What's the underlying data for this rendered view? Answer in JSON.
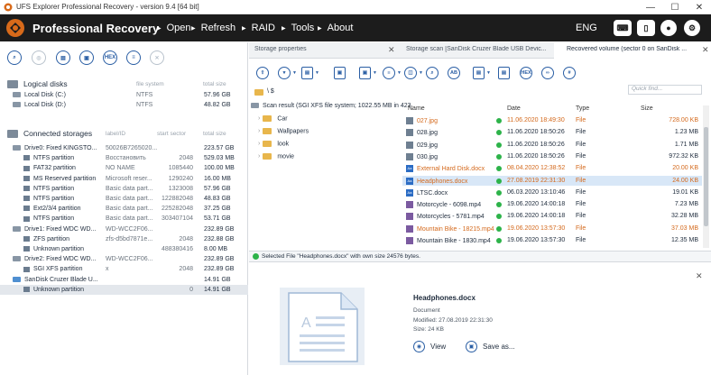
{
  "window": {
    "title": "UFS Explorer Professional Recovery - version 9.4 [64 bit]",
    "minimize": "—",
    "maximize": "☐",
    "close": "✕"
  },
  "menubar": {
    "brand": "Professional Recovery",
    "items": [
      "Open",
      "Refresh",
      "RAID",
      "Tools",
      "About"
    ],
    "language": "ENG"
  },
  "left_toolbar": [
    "search-icon",
    "globe-icon",
    "disk-icon",
    "lock-icon",
    "HEX",
    "list-icon",
    "close-icon"
  ],
  "logical_disks": {
    "title": "Logical disks",
    "col_fs": "file system",
    "col_size": "total size",
    "rows": [
      {
        "name": "Local Disk (C:)",
        "fs": "NTFS",
        "size": "57.96 GB"
      },
      {
        "name": "Local Disk (D:)",
        "fs": "NTFS",
        "size": "48.82 GB"
      }
    ]
  },
  "connected_storages": {
    "title": "Connected storages",
    "col_label": "label/ID",
    "col_start": "start sector",
    "col_size": "total size",
    "rows": [
      {
        "kind": "drive",
        "name": "Drive0: Fixed KINGSTO...",
        "label": "50026B7265020...",
        "start": "",
        "size": "223.57 GB"
      },
      {
        "kind": "part",
        "name": "NTFS partition",
        "label": "Восстановить",
        "start": "2048",
        "size": "529.03 MB"
      },
      {
        "kind": "part",
        "name": "FAT32 partition",
        "label": "NO NAME",
        "start": "1085440",
        "size": "100.00 MB"
      },
      {
        "kind": "part",
        "name": "MS Reserved partition",
        "label": "Microsoft reser...",
        "start": "1290240",
        "size": "16.00 MB"
      },
      {
        "kind": "part",
        "name": "NTFS partition",
        "label": "Basic data part...",
        "start": "1323008",
        "size": "57.96 GB"
      },
      {
        "kind": "part",
        "name": "NTFS partition",
        "label": "Basic data part...",
        "start": "122882048",
        "size": "48.83 GB"
      },
      {
        "kind": "part",
        "name": "Ext2/3/4 partition",
        "label": "Basic data part...",
        "start": "225282048",
        "size": "37.25 GB"
      },
      {
        "kind": "part",
        "name": "NTFS partition",
        "label": "Basic data part...",
        "start": "303407104",
        "size": "53.71 GB"
      },
      {
        "kind": "drive",
        "name": "Drive1: Fixed WDC WD...",
        "label": "WD-WCC2F06...",
        "start": "",
        "size": "232.89 GB"
      },
      {
        "kind": "part",
        "name": "ZFS partition",
        "label": "zfs-d5bd7871e...",
        "start": "2048",
        "size": "232.88 GB"
      },
      {
        "kind": "part",
        "name": "Unknown partition",
        "label": "",
        "start": "488380416",
        "size": "8.00 MB"
      },
      {
        "kind": "drive",
        "name": "Drive2: Fixed WDC WD...",
        "label": "WD-WCC2F06...",
        "start": "",
        "size": "232.89 GB"
      },
      {
        "kind": "part",
        "name": "SGI XFS partition",
        "label": "x",
        "start": "2048",
        "size": "232.89 GB"
      },
      {
        "kind": "usb",
        "name": "SanDisk Cruzer Blade U...",
        "label": "",
        "start": "",
        "size": "14.91 GB"
      },
      {
        "kind": "part-sel",
        "name": "Unknown partition",
        "label": "",
        "start": "0",
        "size": "14.91 GB"
      }
    ]
  },
  "tabs": [
    {
      "label": "Storage properties"
    },
    {
      "label": "Storage scan [SanDisk Cruzer Blade USB Devic..."
    },
    {
      "label": "Recovered volume (sector 0 on SanDisk ..."
    }
  ],
  "right_toolbar": [
    "upload-icon",
    "filter-icon",
    "save-icon",
    "image-icon",
    "image-icon",
    "list-icon",
    "view-icon",
    "search-icon",
    "AB",
    "doc-icon",
    "doc-icon",
    "HEX",
    "link-icon",
    "hash-icon"
  ],
  "quick_find_placeholder": "Quick find...",
  "path": "\\ $",
  "tree": {
    "root": "Scan result (SGI XFS file system; 1022.55 MB in 423",
    "folders": [
      "Car",
      "Wallpapers",
      "look",
      "movie"
    ]
  },
  "grid": {
    "headers": {
      "name": "Name",
      "date": "Date",
      "type": "Type",
      "size": "Size"
    },
    "rows": [
      {
        "name": "027.jpg",
        "date": "11.06.2020 18:49:30",
        "type": "File",
        "size": "728.00 KB",
        "icon": "jpg",
        "orange": true
      },
      {
        "name": "028.jpg",
        "date": "11.06.2020 18:50:26",
        "type": "File",
        "size": "1.23 MB",
        "icon": "jpg",
        "orange": false
      },
      {
        "name": "029.jpg",
        "date": "11.06.2020 18:50:26",
        "type": "File",
        "size": "1.71 MB",
        "icon": "jpg",
        "orange": false
      },
      {
        "name": "030.jpg",
        "date": "11.06.2020 18:50:26",
        "type": "File",
        "size": "972.32 KB",
        "icon": "jpg",
        "orange": false
      },
      {
        "name": "External Hard Disk.docx",
        "date": "08.04.2020 12:38:52",
        "type": "File",
        "size": "20.00 KB",
        "icon": "doc",
        "orange": true
      },
      {
        "name": "Headphones.docx",
        "date": "27.08.2019 22:31:30",
        "type": "File",
        "size": "24.00 KB",
        "icon": "doc",
        "orange": true,
        "selected": true
      },
      {
        "name": "LTSC.docx",
        "date": "06.03.2020 13:10:46",
        "type": "File",
        "size": "19.01 KB",
        "icon": "doc",
        "orange": false
      },
      {
        "name": "Motorcycle - 6098.mp4",
        "date": "19.06.2020 14:00:18",
        "type": "File",
        "size": "7.23 MB",
        "icon": "mp4",
        "orange": false
      },
      {
        "name": "Motorcycles - 5781.mp4",
        "date": "19.06.2020 14:00:18",
        "type": "File",
        "size": "32.28 MB",
        "icon": "mp4",
        "orange": false
      },
      {
        "name": "Mountain Bike - 18215.mp4",
        "date": "19.06.2020 13:57:30",
        "type": "File",
        "size": "37.03 MB",
        "icon": "mp4",
        "orange": true
      },
      {
        "name": "Mountain Bike - 1830.mp4",
        "date": "19.06.2020 13:57:30",
        "type": "File",
        "size": "12.35 MB",
        "icon": "mp4",
        "orange": false
      }
    ]
  },
  "status": "Selected File \"Headphones.docx\" with own size 24576 bytes.",
  "preview": {
    "name": "Headphones.docx",
    "type": "Document",
    "modified": "Modified: 27.08.2019 22:31:30",
    "size": "Size: 24 KB",
    "view": "View",
    "save": "Save as..."
  }
}
